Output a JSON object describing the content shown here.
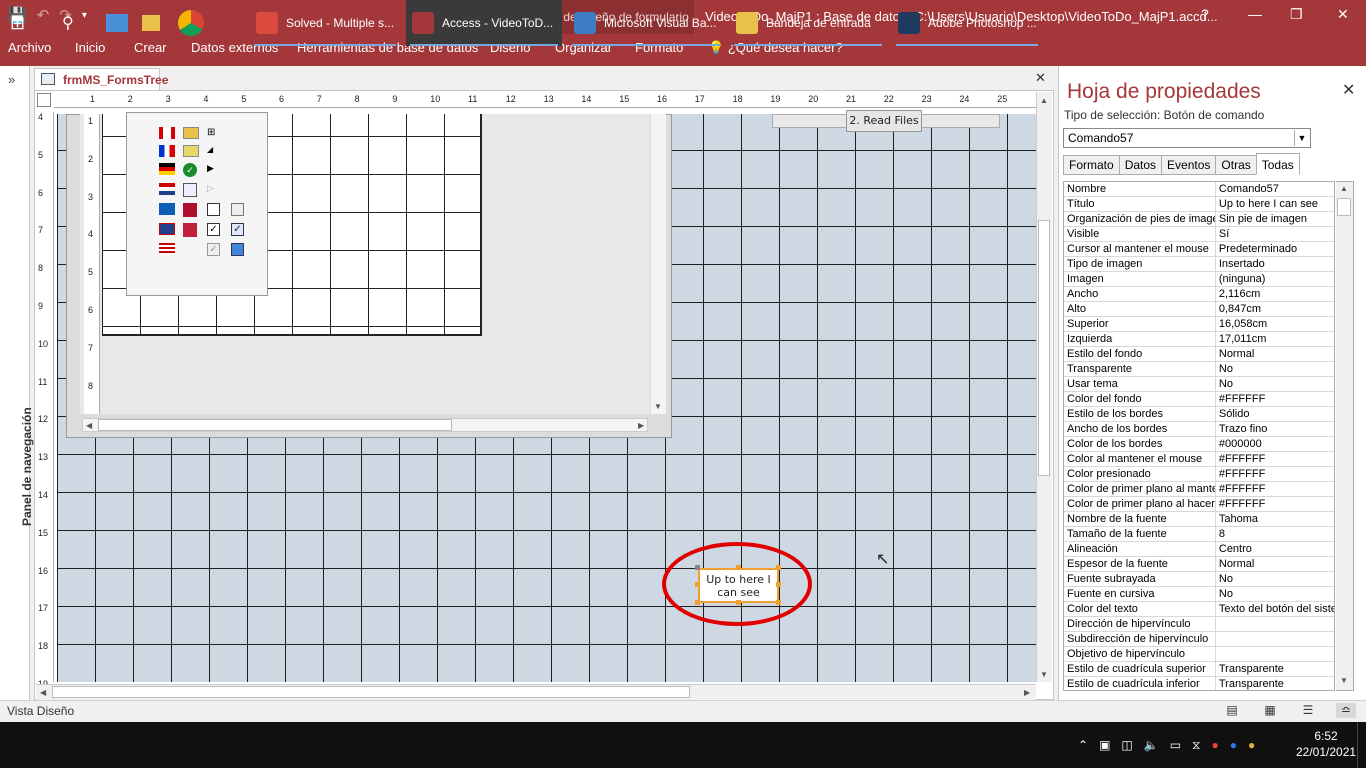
{
  "window": {
    "context_label": "Herramientas de diseño de formulario",
    "doc_title": "VideoToDo_MajP1 : Base de datos- C:\\Users\\Usuario\\Desktop\\VideoToDo_MajP1.accd...",
    "help": "?",
    "minimize": "—",
    "restore": "❐",
    "close": "✕"
  },
  "ribbon": {
    "tabs": [
      "Archivo",
      "Inicio",
      "Crear",
      "Datos externos",
      "Herramientas de base de datos",
      "Diseño",
      "Organizar",
      "Formato"
    ],
    "tell_me": "¿Qué desea hacer?"
  },
  "navpane": {
    "label": "Panel de navegación",
    "expand": "»"
  },
  "document": {
    "tab": "frmMS_FormsTree",
    "close": "✕"
  },
  "ruler": {
    "h": [
      "1",
      "2",
      "3",
      "4",
      "5",
      "6",
      "7",
      "8",
      "9",
      "10",
      "11",
      "12",
      "13",
      "14",
      "15",
      "16",
      "17",
      "18",
      "19",
      "20",
      "21",
      "22",
      "23",
      "24",
      "25"
    ],
    "v": [
      "4",
      "5",
      "6",
      "7",
      "8",
      "9",
      "10",
      "11",
      "12",
      "13",
      "14",
      "15",
      "16",
      "17",
      "18",
      "19"
    ],
    "sub_v": [
      "1",
      "2",
      "3",
      "4",
      "5",
      "6",
      "7",
      "8"
    ]
  },
  "form": {
    "read_files_button": "2. Read Files",
    "command_button": "Up to here I can see"
  },
  "properties": {
    "title": "Hoja de propiedades",
    "selection_label": "Tipo de selección:  Botón de comando",
    "selected_object": "Comando57",
    "tabs": [
      "Formato",
      "Datos",
      "Eventos",
      "Otras",
      "Todas"
    ],
    "active_tab": "Todas",
    "rows": [
      [
        "Nombre",
        "Comando57"
      ],
      [
        "Título",
        "Up to here I can see"
      ],
      [
        "Organización de pies de imagen",
        "Sin pie de imagen"
      ],
      [
        "Visible",
        "Sí"
      ],
      [
        "Cursor al mantener el mouse",
        "Predeterminado"
      ],
      [
        "Tipo de imagen",
        "Insertado"
      ],
      [
        "Imagen",
        "(ninguna)"
      ],
      [
        "Ancho",
        "2,116cm"
      ],
      [
        "Alto",
        "0,847cm"
      ],
      [
        "Superior",
        "16,058cm"
      ],
      [
        "Izquierda",
        "17,011cm"
      ],
      [
        "Estilo del fondo",
        "Normal"
      ],
      [
        "Transparente",
        "No"
      ],
      [
        "Usar tema",
        "No"
      ],
      [
        "Color del fondo",
        "#FFFFFF"
      ],
      [
        "Estilo de los bordes",
        "Sólido"
      ],
      [
        "Ancho de los bordes",
        "Trazo fino"
      ],
      [
        "Color de los bordes",
        "#000000"
      ],
      [
        "Color al mantener el mouse",
        "#FFFFFF"
      ],
      [
        "Color presionado",
        "#FFFFFF"
      ],
      [
        "Color de primer plano al mantener",
        "#FFFFFF"
      ],
      [
        "Color de primer plano al hacer clic",
        "#FFFFFF"
      ],
      [
        "Nombre de la fuente",
        "Tahoma"
      ],
      [
        "Tamaño de la fuente",
        "8"
      ],
      [
        "Alineación",
        "Centro"
      ],
      [
        "Espesor de la fuente",
        "Normal"
      ],
      [
        "Fuente subrayada",
        "No"
      ],
      [
        "Fuente en cursiva",
        "No"
      ],
      [
        "Color del texto",
        "Texto del botón del sistema"
      ],
      [
        "Dirección de hipervínculo",
        ""
      ],
      [
        "Subdirección de hipervínculo",
        ""
      ],
      [
        "Objetivo de hipervínculo",
        ""
      ],
      [
        "Estilo de cuadrícula superior",
        "Transparente"
      ],
      [
        "Estilo de cuadrícula inferior",
        "Transparente"
      ]
    ]
  },
  "status": {
    "text": "Vista Diseño"
  },
  "taskbar": {
    "items": [
      {
        "label": "Solved - Multiple s...",
        "color": "#dd4b3e"
      },
      {
        "label": "Access - VideoToD...",
        "color": "#a4373a"
      },
      {
        "label": "Microsoft Visual Ba...",
        "color": "#3c7dc4"
      },
      {
        "label": "Bandeja de entrada",
        "color": "#e8c04a"
      },
      {
        "label": "Adobe Photoshop ...",
        "color": "#1e3a5f"
      }
    ],
    "time": "6:52",
    "date": "22/01/2021"
  }
}
